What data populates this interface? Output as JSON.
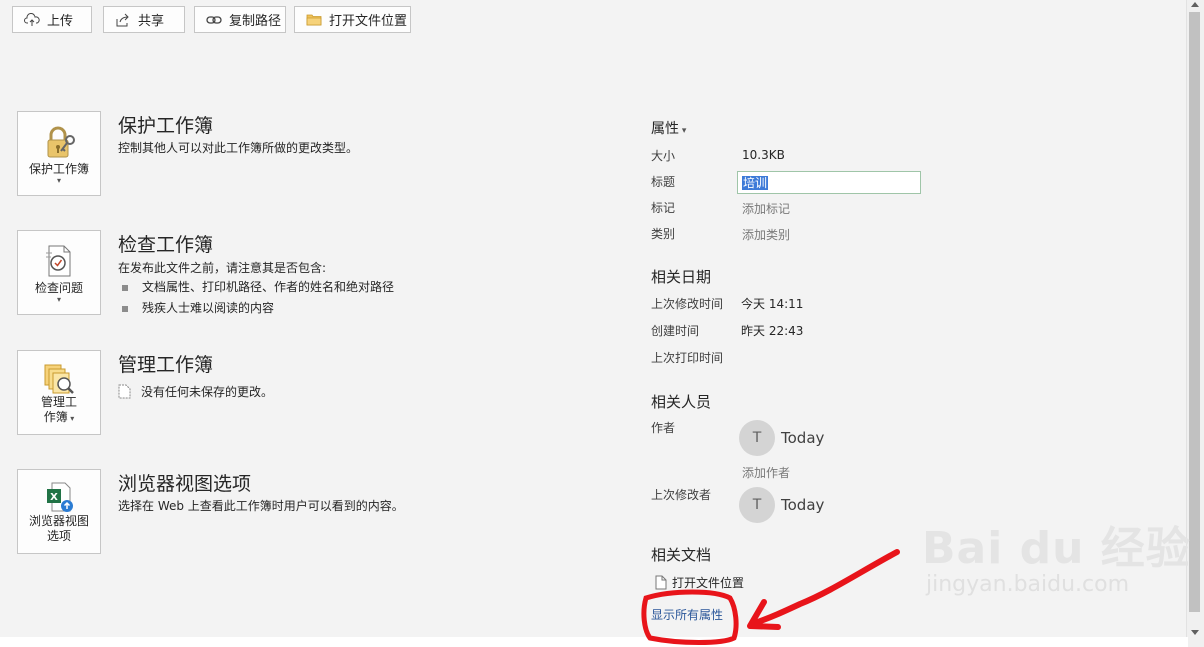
{
  "toolbar": {
    "upload": "上传",
    "share": "共享",
    "copy_path": "复制路径",
    "open_location": "打开文件位置"
  },
  "sections": [
    {
      "button": "保护工作簿",
      "title": "保护工作簿",
      "description": "控制其他人可以对此工作簿所做的更改类型。"
    },
    {
      "button": "检查问题",
      "title": "检查工作簿",
      "description": "在发布此文件之前，请注意其是否包含:",
      "bullets": [
        "文档属性、打印机路径、作者的姓名和绝对路径",
        "残疾人士难以阅读的内容"
      ]
    },
    {
      "button_line1": "管理工",
      "button_line2": "作簿",
      "title": "管理工作簿",
      "description": "没有任何未保存的更改。"
    },
    {
      "button_line1": "浏览器视图",
      "button_line2": "选项",
      "title": "浏览器视图选项",
      "description": "选择在 Web 上查看此工作簿时用户可以看到的内容。"
    }
  ],
  "properties": {
    "header": "属性",
    "size_label": "大小",
    "size_value": "10.3KB",
    "title_label": "标题",
    "title_value": "培训",
    "tags_label": "标记",
    "tags_placeholder": "添加标记",
    "category_label": "类别",
    "category_placeholder": "添加类别"
  },
  "dates": {
    "header": "相关日期",
    "modified_label": "上次修改时间",
    "modified_value": "今天 14:11",
    "created_label": "创建时间",
    "created_value": "昨天 22:43",
    "printed_label": "上次打印时间"
  },
  "people": {
    "header": "相关人员",
    "author_label": "作者",
    "author_initial": "T",
    "author_name": "Today",
    "add_author": "添加作者",
    "last_modified_by_label": "上次修改者",
    "modifier_initial": "T",
    "modifier_name": "Today"
  },
  "documents": {
    "header": "相关文档",
    "open_location": "打开文件位置",
    "show_all": "显示所有属性"
  },
  "watermark": {
    "main": "Bai du 经验",
    "sub": "jingyan.baidu.com"
  },
  "colors": {
    "annotation": "#e8141a",
    "link": "#2b579a",
    "background": "#f3f3f3"
  }
}
